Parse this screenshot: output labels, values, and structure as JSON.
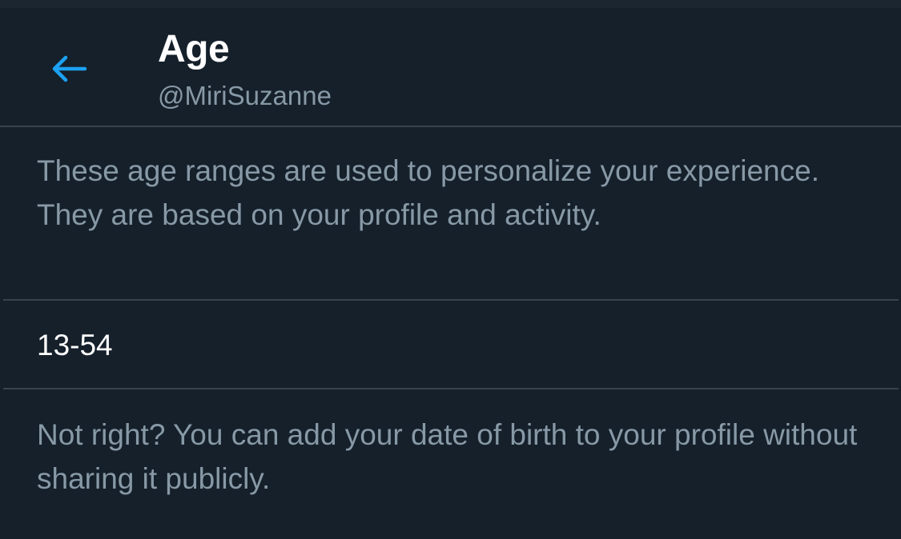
{
  "header": {
    "back_icon": "arrow-left-icon",
    "title": "Age",
    "handle": "@MiriSuzanne"
  },
  "main": {
    "description": "These age ranges are used to personalize your experience. They are based on your profile and activity.",
    "age_range": "13-54",
    "note": "Not right? You can add your date of birth to your profile without sharing it publicly."
  },
  "colors": {
    "background": "#15202b",
    "accent": "#1da1f2",
    "primary_text": "#ffffff",
    "secondary_text": "#8899a6",
    "divider": "#38444d"
  }
}
